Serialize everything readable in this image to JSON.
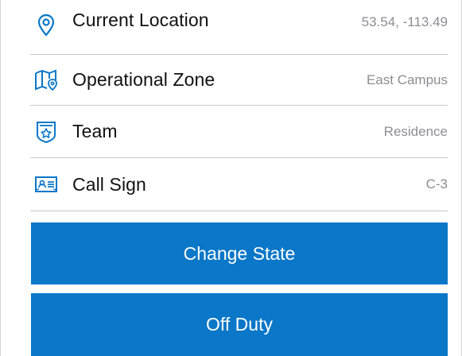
{
  "rows": [
    {
      "icon": "location-pin-icon",
      "label": "Current Location",
      "value": "53.54, -113.49"
    },
    {
      "icon": "map-zone-icon",
      "label": "Operational Zone",
      "value": "East Campus"
    },
    {
      "icon": "team-shield-icon",
      "label": "Team",
      "value": "Residence"
    },
    {
      "icon": "id-card-icon",
      "label": "Call Sign",
      "value": "C-3"
    }
  ],
  "buttons": {
    "change_state": "Change State",
    "off_duty": "Off Duty"
  },
  "colors": {
    "accent": "#0A77C8",
    "icon": "#0A77C8",
    "label": "#111111",
    "value": "#8E8E93",
    "divider": "#C8C8CC"
  }
}
